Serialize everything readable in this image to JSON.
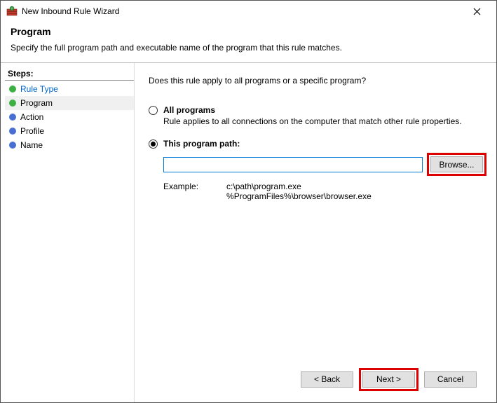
{
  "titlebar": {
    "title": "New Inbound Rule Wizard"
  },
  "header": {
    "title": "Program",
    "subtitle": "Specify the full program path and executable name of the program that this rule matches."
  },
  "sidebar": {
    "title": "Steps:",
    "items": [
      {
        "label": "Rule Type",
        "state": "done"
      },
      {
        "label": "Program",
        "state": "active"
      },
      {
        "label": "Action",
        "state": "pending"
      },
      {
        "label": "Profile",
        "state": "pending"
      },
      {
        "label": "Name",
        "state": "pending"
      }
    ]
  },
  "content": {
    "prompt": "Does this rule apply to all programs or a specific program?",
    "option_all": {
      "title": "All programs",
      "desc": "Rule applies to all connections on the computer that match other rule properties."
    },
    "option_path": {
      "title": "This program path:",
      "value": "",
      "browse": "Browse...",
      "example_label": "Example:",
      "example_paths": "c:\\path\\program.exe\n%ProgramFiles%\\browser\\browser.exe"
    }
  },
  "footer": {
    "back": "< Back",
    "next": "Next >",
    "cancel": "Cancel"
  }
}
